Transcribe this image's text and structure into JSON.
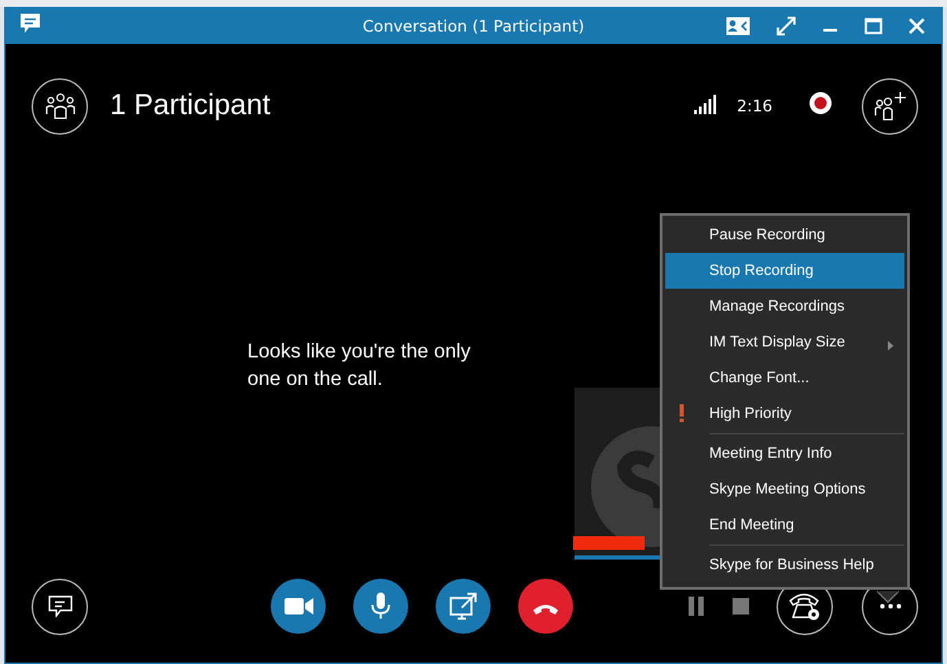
{
  "window": {
    "title": "Conversation (1 Participant)"
  },
  "header": {
    "title": "1 Participant",
    "duration": "2:16",
    "recording": true
  },
  "message": "Looks like you're the only one on the call.",
  "menu": {
    "groups": [
      [
        {
          "label": "Pause Recording",
          "selected": false,
          "submenu": false,
          "flag": false
        },
        {
          "label": "Stop Recording",
          "selected": true,
          "submenu": false,
          "flag": false
        },
        {
          "label": "Manage Recordings",
          "selected": false,
          "submenu": false,
          "flag": false
        },
        {
          "label": "IM Text Display Size",
          "selected": false,
          "submenu": true,
          "flag": false
        },
        {
          "label": "Change Font...",
          "selected": false,
          "submenu": false,
          "flag": false
        },
        {
          "label": "High Priority",
          "selected": false,
          "submenu": false,
          "flag": true
        }
      ],
      [
        {
          "label": "Meeting Entry Info",
          "selected": false,
          "submenu": false,
          "flag": false
        },
        {
          "label": "Skype Meeting Options",
          "selected": false,
          "submenu": false,
          "flag": false
        },
        {
          "label": "End Meeting",
          "selected": false,
          "submenu": false,
          "flag": false
        }
      ],
      [
        {
          "label": "Skype for Business Help",
          "selected": false,
          "submenu": false,
          "flag": false
        }
      ]
    ]
  },
  "controls": [
    {
      "kind": "video"
    },
    {
      "kind": "mic"
    },
    {
      "kind": "share"
    },
    {
      "kind": "hangup"
    }
  ]
}
